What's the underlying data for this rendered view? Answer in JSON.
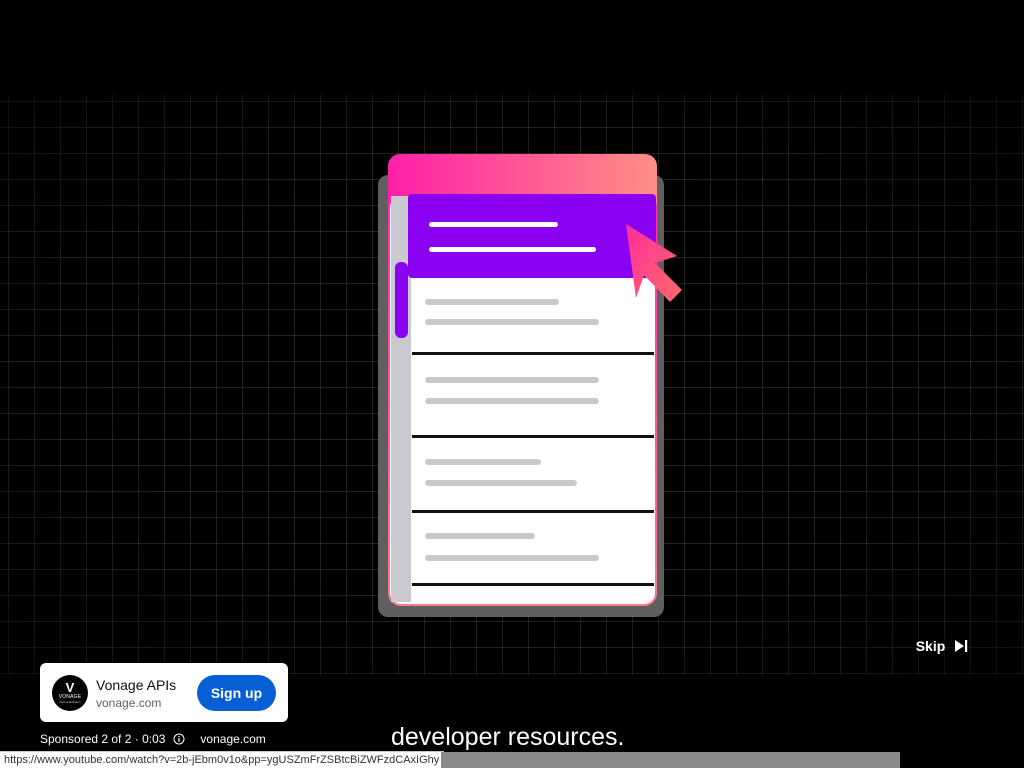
{
  "skip": {
    "label": "Skip",
    "icon": "skip-next-icon"
  },
  "ad": {
    "logo_mark": "V",
    "logo_word": "VONAGE",
    "logo_sub": "Part of Ericsson",
    "advertiser_name": "Vonage APIs",
    "advertiser_domain": "vonage.com",
    "cta_label": "Sign up",
    "cta_color": "#065fd4"
  },
  "sponsored": {
    "label": "Sponsored 2 of 2 · 0:03",
    "info_icon": "info-icon",
    "domain": "vonage.com"
  },
  "caption": {
    "text": "developer resources."
  },
  "status_bar": {
    "url": "https://www.youtube.com/watch?v=2b-jEbm0v1o&pp=ygUSZmFrZSBtcBiZWFzdCAxIGhy"
  },
  "colors": {
    "background": "#000000",
    "panel_header_gradient_start": "#ff1fa8",
    "panel_header_gradient_end": "#ff8a80",
    "highlight_purple": "#8a00f0",
    "cursor_pink": "#ff3d7f"
  }
}
